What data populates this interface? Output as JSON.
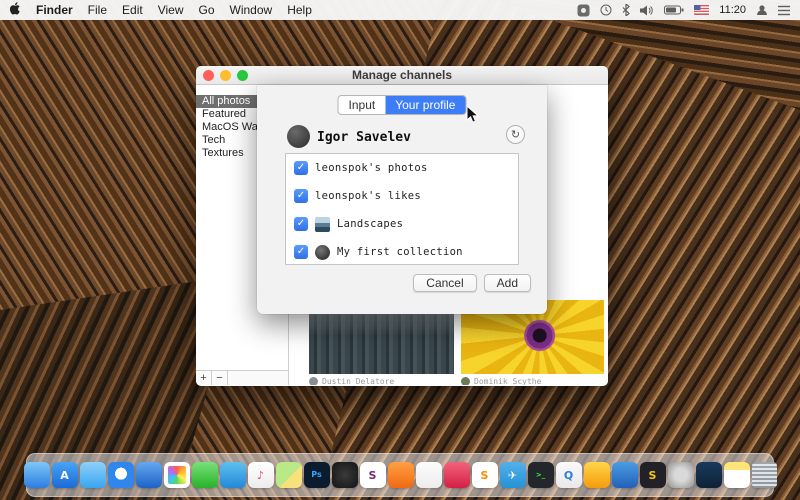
{
  "menu_bar": {
    "app_name": "Finder",
    "items": [
      "File",
      "Edit",
      "View",
      "Go",
      "Window",
      "Help"
    ],
    "time": "11:20"
  },
  "window": {
    "title": "Manage channels",
    "sidebar": {
      "items": [
        "All photos",
        "Featured",
        "MacOS Wallpapers",
        "Tech",
        "Textures"
      ],
      "selected_index": 0,
      "add_label": "+",
      "remove_label": "−"
    },
    "photo_cards": [
      {
        "author": "Dustin Delatore"
      },
      {
        "author": "Dominik Scythe"
      }
    ]
  },
  "sheet": {
    "tabs": [
      {
        "label": "Input",
        "selected": false
      },
      {
        "label": "Your profile",
        "selected": true
      }
    ],
    "profile_name": "Igor Savelev",
    "refresh_icon": "↻",
    "check_icon": "✓",
    "channels": [
      {
        "label": "leonspok's photos",
        "checked": true,
        "thumb": "none"
      },
      {
        "label": "leonspok's likes",
        "checked": true,
        "thumb": "none"
      },
      {
        "label": "Landscapes",
        "checked": true,
        "thumb": "mountain"
      },
      {
        "label": "My first collection",
        "checked": true,
        "thumb": "dark"
      }
    ],
    "cancel_label": "Cancel",
    "add_label": "Add"
  },
  "colors": {
    "accent_blue": "#3d7ef8",
    "checkbox_blue": "#2f6fe8",
    "selection_gray": "#6f6f6f"
  },
  "dock": {
    "apps": [
      {
        "name": "finder",
        "glyph": ""
      },
      {
        "name": "app-store",
        "glyph": "A"
      },
      {
        "name": "twitter",
        "glyph": ""
      },
      {
        "name": "safari",
        "glyph": ""
      },
      {
        "name": "mail",
        "glyph": ""
      },
      {
        "name": "photos",
        "glyph": ""
      },
      {
        "name": "messages",
        "glyph": ""
      },
      {
        "name": "facetime",
        "glyph": ""
      },
      {
        "name": "itunes",
        "glyph": "♪"
      },
      {
        "name": "maps",
        "glyph": ""
      },
      {
        "name": "photoshop",
        "glyph": "Ps"
      },
      {
        "name": "pixelmator",
        "glyph": ""
      },
      {
        "name": "slack",
        "glyph": "S"
      },
      {
        "name": "reeder",
        "glyph": ""
      },
      {
        "name": "bear",
        "glyph": ""
      },
      {
        "name": "pocket",
        "glyph": ""
      },
      {
        "name": "sublime-text",
        "glyph": "S"
      },
      {
        "name": "telegram",
        "glyph": "✈"
      },
      {
        "name": "terminal",
        "glyph": ">_"
      },
      {
        "name": "quicktime",
        "glyph": "Q"
      },
      {
        "name": "hazel",
        "glyph": ""
      },
      {
        "name": "transmit",
        "glyph": ""
      },
      {
        "name": "sketch",
        "glyph": "S"
      },
      {
        "name": "system-preferences",
        "glyph": ""
      },
      {
        "name": "xcode",
        "glyph": ""
      },
      {
        "name": "notes",
        "glyph": ""
      },
      {
        "name": "trash",
        "glyph": ""
      }
    ]
  }
}
